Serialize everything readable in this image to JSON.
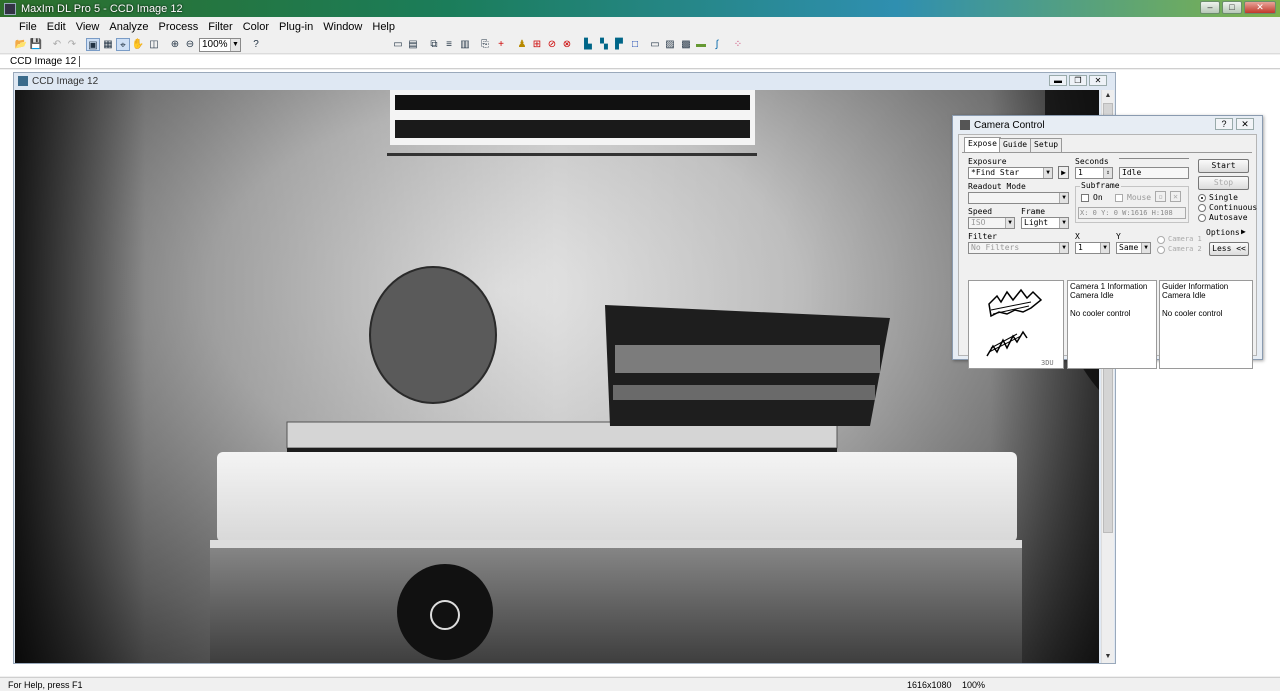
{
  "window": {
    "title": "MaxIm DL Pro 5 - CCD Image 12",
    "minimize": "–",
    "maximize": "□",
    "close": "✕"
  },
  "menu": [
    "File",
    "Edit",
    "View",
    "Analyze",
    "Process",
    "Filter",
    "Color",
    "Plug-in",
    "Window",
    "Help"
  ],
  "toolbar": {
    "zoom": "100%"
  },
  "doc_tab": "CCD Image 12",
  "image_window": {
    "title": "CCD Image 12",
    "minimize": "▬",
    "restore": "❐",
    "close": "✕"
  },
  "camera_control": {
    "title": "Camera Control",
    "help_btn": "?",
    "close_btn": "✕",
    "tabs": [
      "Expose",
      "Guide",
      "Setup"
    ],
    "exposure_label": "Exposure",
    "exposure_value": "*Find Star",
    "seconds_label": "Seconds",
    "seconds_value": "1",
    "status_value": "Idle",
    "readout_label": "Readout Mode",
    "readout_value": "",
    "subframe_label": "Subframe",
    "on_label": "On",
    "mouse_label": "Mouse",
    "subframe_coords": "X:    0 Y:    0 W:1616 H:108",
    "speed_label": "Speed",
    "speed_value": "ISO",
    "frame_label": "Frame",
    "frame_value": "Light",
    "filter_label": "Filter",
    "filter_value": "No Filters",
    "x_label": "X",
    "x_value": "1",
    "y_label": "Y",
    "y_value": "Same",
    "camera1_label": "Camera 1",
    "camera2_label": "Camera 2",
    "start_btn": "Start",
    "stop_btn": "Stop",
    "mode_single": "Single",
    "mode_continuous": "Continuous",
    "mode_autosave": "Autosave",
    "options_btn": "Options",
    "less_btn": "Less <<",
    "camera1_info": [
      "Camera 1 Information",
      "Camera Idle",
      "",
      "No cooler control"
    ],
    "guider_info": [
      "Guider Information",
      "Camera Idle",
      "",
      "No cooler control"
    ],
    "logo_text": "3DU"
  },
  "statusbar": {
    "help": "For Help, press F1",
    "dims": "1616x1080",
    "zoom": "100%"
  }
}
